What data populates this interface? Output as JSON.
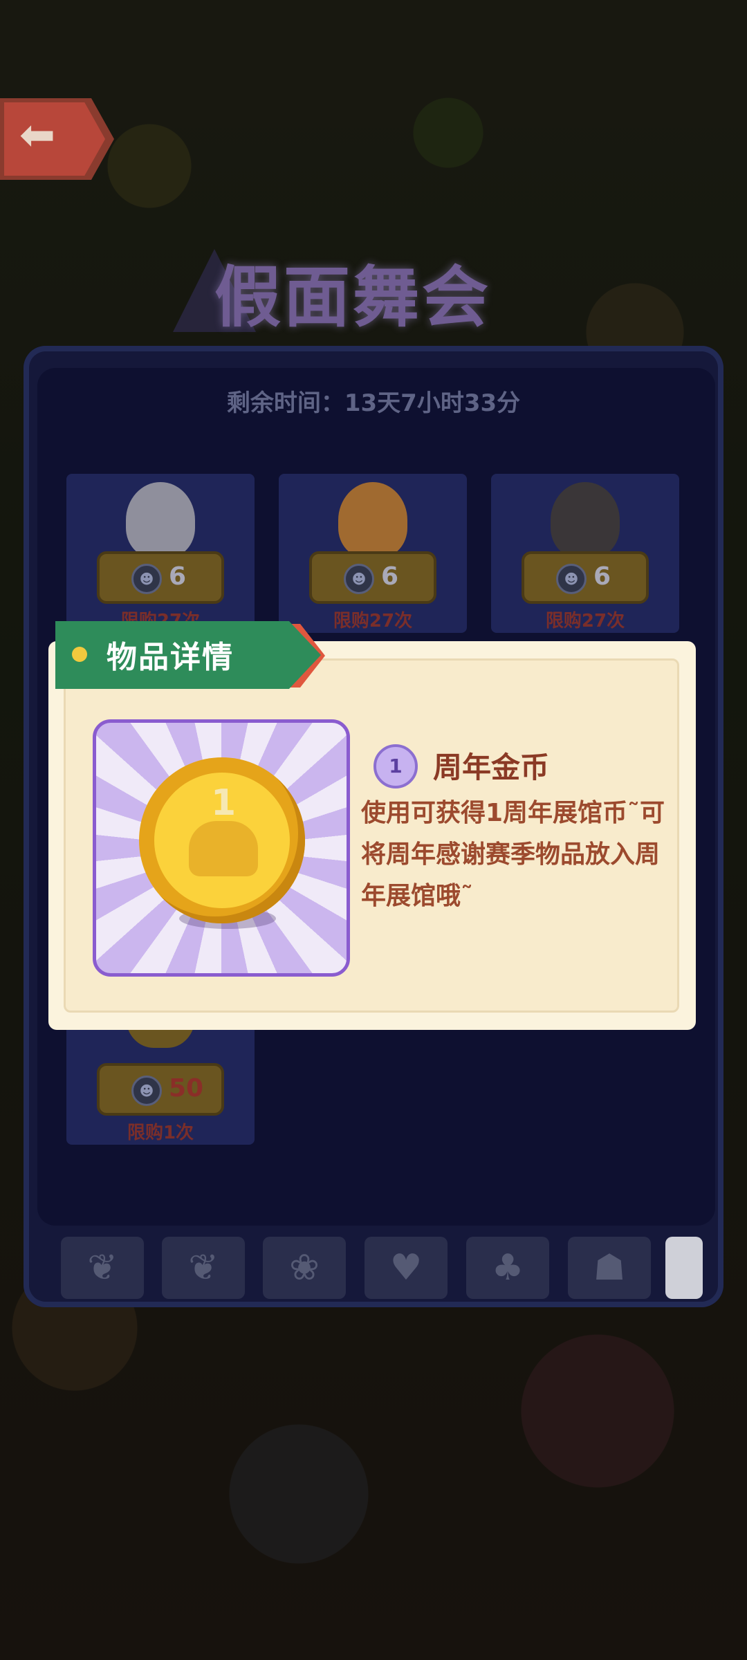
{
  "event": {
    "title": "假面舞会",
    "remaining_time": "剩余时间：13天7小时33分"
  },
  "shop": {
    "items": [
      {
        "price": "6",
        "limit": "限购27次",
        "figure_color": "#8f8f9c"
      },
      {
        "price": "6",
        "limit": "限购27次",
        "figure_color": "#a06a30"
      },
      {
        "price": "6",
        "limit": "限购27次",
        "figure_color": "#3a3638"
      },
      {
        "price": "50",
        "limit": "限购1次",
        "figure_color": "#6a5520"
      }
    ],
    "currency_icon": "mask-coin-icon"
  },
  "tabs": [
    {
      "icon": "leaf-icon",
      "glyph": "❦"
    },
    {
      "icon": "leaf-icon",
      "glyph": "❦"
    },
    {
      "icon": "pets-icon",
      "glyph": "❀"
    },
    {
      "icon": "heart-box-icon",
      "glyph": "♥"
    },
    {
      "icon": "tree-icon",
      "glyph": "♣"
    },
    {
      "icon": "cat-icon",
      "glyph": "☗"
    }
  ],
  "popup": {
    "header": "物品详情",
    "item_level": "1",
    "item_name": "周年金币",
    "item_description": "使用可获得1周年展馆币˜可将周年感谢赛季物品放入周年展馆哦˜",
    "coin_number": "1"
  },
  "back_button": {
    "icon": "back-arrow-icon",
    "glyph": "⬅"
  },
  "colors": {
    "popup_bg": "#fbf3dd",
    "header_green": "#2e8c5a",
    "header_accent": "#e0573e",
    "text_brown": "#9c4a2e",
    "frame_purple": "#8a5ccf",
    "coin_gold": "#fbd23b"
  }
}
